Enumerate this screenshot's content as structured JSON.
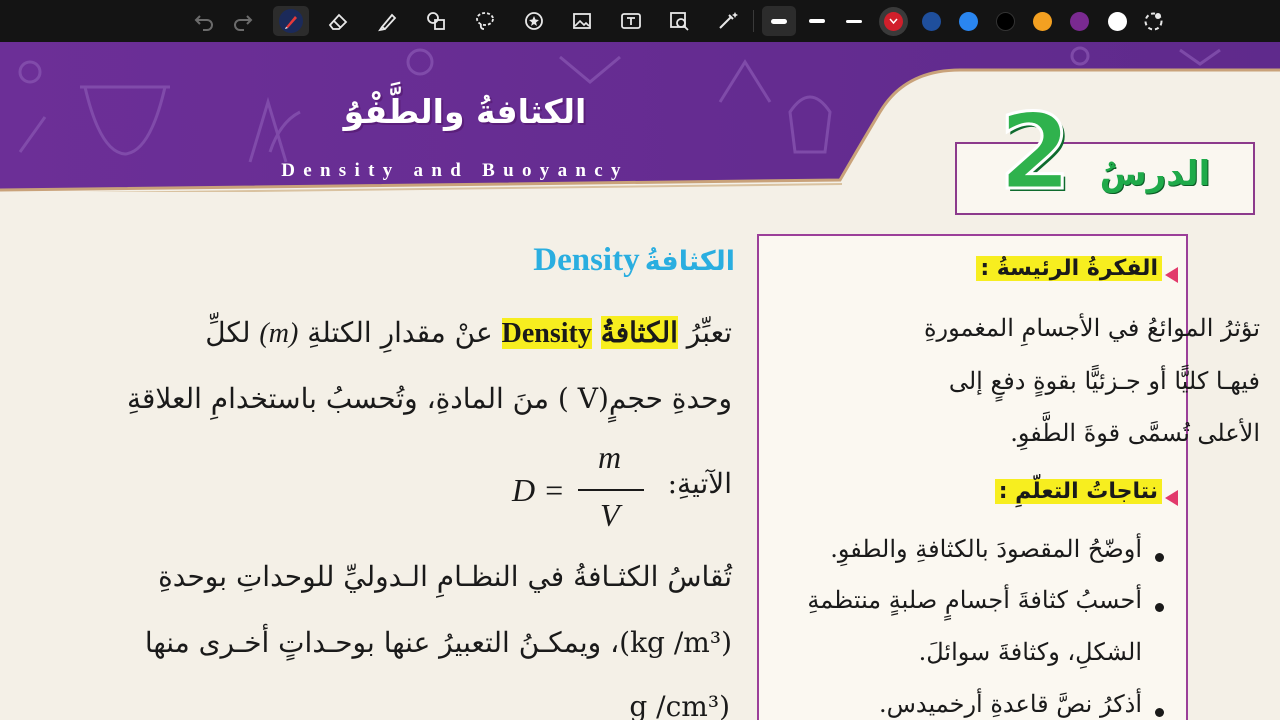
{
  "toolbar": {
    "tools": [
      "undo-icon",
      "redo-icon",
      "laser-pen-icon",
      "eraser-icon",
      "highlighter-icon",
      "shapes-icon",
      "lasso-icon",
      "sticker-icon",
      "image-icon",
      "text-box-icon",
      "scan-icon",
      "magic-wand-icon"
    ],
    "stroke_sizes": [
      "thick",
      "medium",
      "thin"
    ],
    "colors": [
      "#d11f2b",
      "#1f4f9c",
      "#2a86f0",
      "#000000",
      "#f3a021",
      "#7a2a90",
      "#ffffff"
    ],
    "selected_color": "#d11f2b"
  },
  "banner": {
    "title_ar": "الكثافةُ والطَّفْوُ",
    "title_en": "Density and Buoyancy",
    "lesson_word": "الدرسُ",
    "lesson_number": "2",
    "accent": "#6b2f95"
  },
  "panel": {
    "main_idea_heading": "الفكرةُ الرئيسةُ :",
    "main_idea_lines": [
      "تؤثرُ الموائعُ في الأجسامِ المغمورةِ",
      "فيهـا كليًّا أو جـزئيًّا بقوةٍ دفعٍ إلى",
      "الأعلى تُسمَّى قوةَ الطَّفوِ."
    ],
    "outcomes_heading": "نتاجاتُ التعلّمِ :",
    "outcomes": [
      "أوضّحُ المقصودَ بالكثافةِ والطفوِ.",
      "أحسبُ كثافةَ أجسامٍ صلبةٍ منتظمةِ",
      "الشكلِ، وكثافةَ سوائلَ.",
      "أذكرُ نصَّ قاعدةِ أرخميدس."
    ]
  },
  "content": {
    "section_ar": "الكثافةُ",
    "section_en": "Density",
    "p1_start": "تعبِّرُ",
    "p1_term_ar": "الكثافةُ",
    "p1_term_en": "Density",
    "p1_rest": "عنْ مقدارِ الكتلةِ",
    "p1_m": "(m)",
    "p1_end": "لكلِّ",
    "line2": "وحدةِ حجمٍ(V ) منَ المادةِ، وتُحسبُ باستخدامِ العلاقةِ",
    "line3": "الآتيةِ:",
    "formula_lhs": "D =",
    "formula_num": "m",
    "formula_den": "V",
    "line4": "تُقاسُ الكثـافةُ في النظـامِ الـدوليِّ للوحداتِ بوحدةِ",
    "line5_unit": "(kg /m³)",
    "line5": "، ويمكـنُ التعبيرُ عنها بوحـداتٍ أخـرى منها",
    "line6_unit": "(g /cm³"
  }
}
